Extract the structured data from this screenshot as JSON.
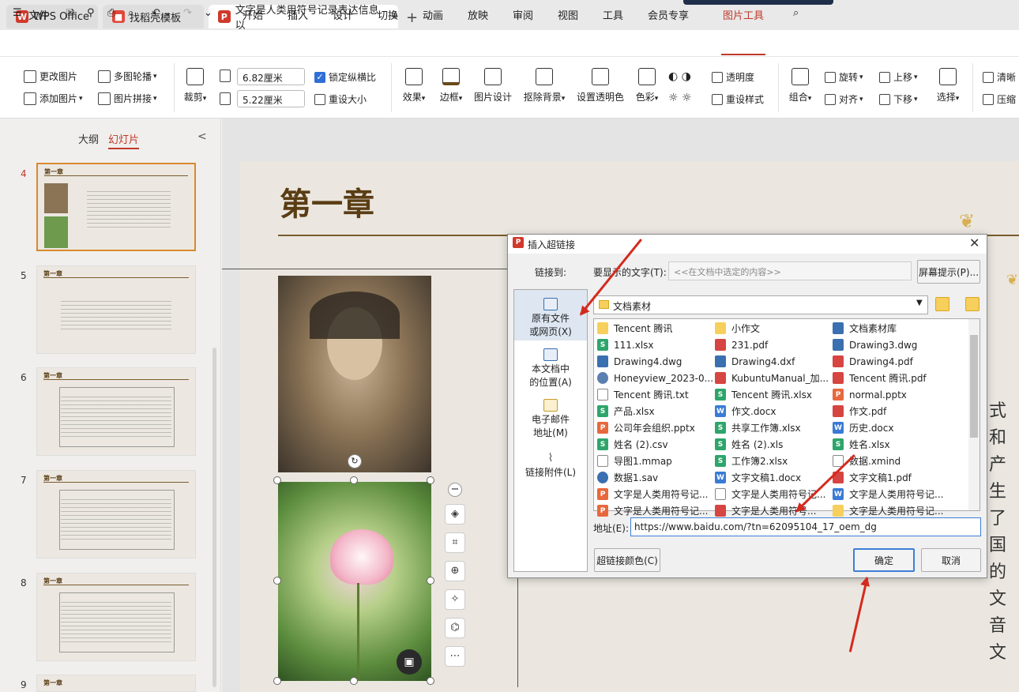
{
  "tabs": {
    "wps": "WPS Office",
    "templates": "找稻壳模板",
    "document": "文字是人类用符号记录表达信息以",
    "add": "+",
    "more": "⌄"
  },
  "menu": {
    "file": "文件",
    "items": [
      "开始",
      "插入",
      "设计",
      "切换",
      "动画",
      "放映",
      "审阅",
      "视图",
      "工具",
      "会员专享",
      "图片工具"
    ]
  },
  "ribbon": {
    "change_picture": "更改图片",
    "add_picture": "添加图片",
    "multi_carousel": "多图轮播",
    "picture_stitch": "图片拼接",
    "crop": "裁剪",
    "width": "6.82厘米",
    "height": "5.22厘米",
    "lock_ratio": "锁定纵横比",
    "reset_size": "重设大小",
    "effects": "效果",
    "border": "边框",
    "picture_design": "图片设计",
    "remove_bg": "抠除背景",
    "set_transparent": "设置透明色",
    "color": "色彩",
    "transparency": "透明度",
    "reset_style": "重设样式",
    "group": "组合",
    "rotate": "旋转",
    "align": "对齐",
    "move_up": "上移",
    "move_down": "下移",
    "select": "选择",
    "clear": "清晰",
    "compress": "压缩"
  },
  "left_panel": {
    "outline_tab": "大纲",
    "slides_tab": "幻灯片",
    "collapse": "<",
    "slides": [
      {
        "num": "4",
        "title": "第一章"
      },
      {
        "num": "5",
        "title": "第一章"
      },
      {
        "num": "6",
        "title": "第一章"
      },
      {
        "num": "7",
        "title": "第一章"
      },
      {
        "num": "8",
        "title": "第一章"
      },
      {
        "num": "9",
        "title": "第一章"
      }
    ]
  },
  "slide": {
    "title": "第一章",
    "side_text": [
      "式和",
      "产生",
      "了国",
      "的文",
      "音文"
    ]
  },
  "dialog": {
    "title": "插入超链接",
    "link_to": "链接到:",
    "display_text_label": "要显示的文字(T):",
    "display_text_value": "<<在文档中选定的内容>>",
    "screen_tip": "屏幕提示(P)...",
    "link_options": [
      "原有文件\n或网页(X)",
      "本文档中\n的位置(A)",
      "电子邮件\n地址(M)",
      "链接附件(L)"
    ],
    "folder": "文档素材",
    "files_col1": [
      "Tencent 腾讯",
      "111.xlsx",
      "Drawing4.dwg",
      "Honeyview_2023-0...",
      "Tencent 腾讯.txt",
      "产品.xlsx",
      "公司年会组织.pptx",
      "姓名 (2).csv",
      "导图1.mmap",
      "数据1.sav",
      "文字是人类用符号记...",
      "文字是人类用符号记..."
    ],
    "files_col2": [
      "小作文",
      "231.pdf",
      "Drawing4.dxf",
      "KubuntuManual_加...",
      "Tencent 腾讯.xlsx",
      "作文.docx",
      "共享工作簿.xlsx",
      "姓名 (2).xls",
      "工作簿2.xlsx",
      "文字文稿1.docx",
      "文字是人类用符号记...",
      "文字是人类用符号..."
    ],
    "files_col3": [
      "文档素材库",
      "Drawing3.dwg",
      "Drawing4.pdf",
      "Tencent 腾讯.pdf",
      "normal.pptx",
      "作文.pdf",
      "历史.docx",
      "姓名.xlsx",
      "数据.xmind",
      "文字文稿1.pdf",
      "文字是人类用符号记...",
      "文字是人类用符号记..."
    ],
    "address_label": "地址(E):",
    "address_value": "https://www.baidu.com/?tn=62095104_17_oem_dg",
    "link_color": "超链接颜色(C)",
    "ok": "确定",
    "cancel": "取消"
  },
  "colors": {
    "accent": "#c0392b",
    "arrow": "#d42a1f",
    "dialog_focus": "#3c7fd8"
  }
}
